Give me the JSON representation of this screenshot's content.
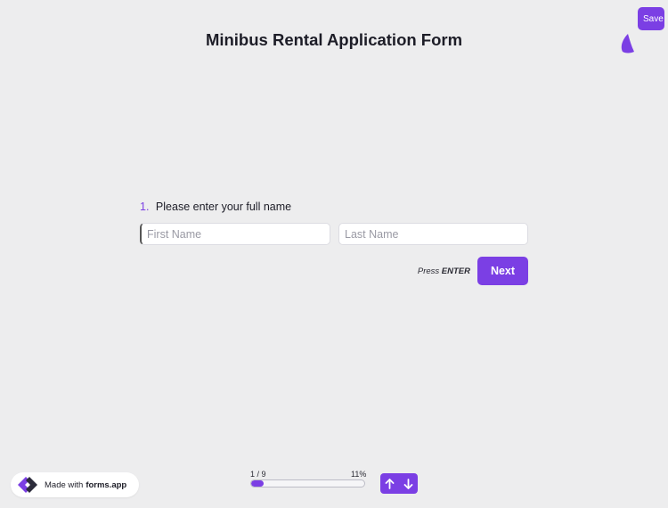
{
  "header": {
    "save_label": "Save",
    "title": "Minibus Rental Application Form"
  },
  "question": {
    "number": "1.",
    "text": "Please enter your full name",
    "first_name_placeholder": "First Name",
    "last_name_placeholder": "Last Name"
  },
  "actions": {
    "press_label": "Press",
    "enter_key": "ENTER",
    "next_label": "Next"
  },
  "footer": {
    "made_with": "Made with",
    "brand": "forms.app",
    "progress_step": "1 / 9",
    "progress_percent_label": "11%",
    "progress_value": 0.11
  },
  "colors": {
    "accent": "#7b3fe4",
    "background": "#ededee"
  },
  "icons": {
    "logo": "forms-app-logo-icon",
    "up": "arrow-up-icon",
    "down": "arrow-down-icon"
  }
}
